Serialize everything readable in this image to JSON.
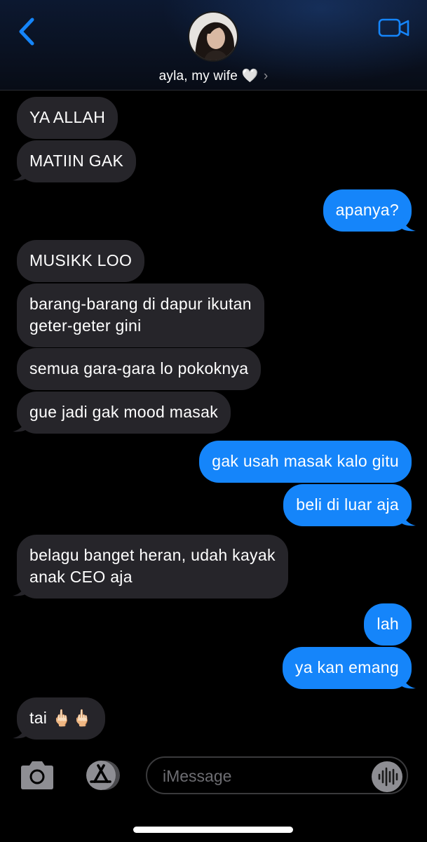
{
  "header": {
    "contact_name": "ayla, my wife 🤍",
    "chevron": "›",
    "back_icon": "chevron-left-icon",
    "video_icon": "video-camera-icon",
    "accent_color": "#1585fa"
  },
  "messages": [
    {
      "direction": "incoming",
      "text": "YA ALLAH"
    },
    {
      "direction": "incoming",
      "text": "MATIIN GAK"
    },
    {
      "direction": "outgoing",
      "text": "apanya?"
    },
    {
      "direction": "incoming",
      "text": "MUSIKK LOO"
    },
    {
      "direction": "incoming",
      "lines": [
        "barang-barang di dapur ikutan",
        "geter-geter gini"
      ]
    },
    {
      "direction": "incoming",
      "text": "semua gara-gara lo pokoknya"
    },
    {
      "direction": "incoming",
      "text": "gue jadi gak mood masak"
    },
    {
      "direction": "outgoing",
      "text": "gak usah masak kalo gitu"
    },
    {
      "direction": "outgoing",
      "text": "beli di luar aja"
    },
    {
      "direction": "incoming",
      "lines": [
        "belagu banget heran, udah kayak",
        "anak CEO aja"
      ]
    },
    {
      "direction": "outgoing",
      "text": "lah"
    },
    {
      "direction": "outgoing",
      "text": "ya kan emang"
    },
    {
      "direction": "incoming",
      "text": "tai 🖕🏻🖕🏻"
    }
  ],
  "composer": {
    "placeholder": "iMessage",
    "camera_icon": "camera-icon",
    "apps_icon": "app-store-icon",
    "mic_icon": "audio-waveform-icon"
  },
  "colors": {
    "incoming_bubble": "#26252a",
    "outgoing_bubble": "#1585fa",
    "background": "#000000"
  }
}
